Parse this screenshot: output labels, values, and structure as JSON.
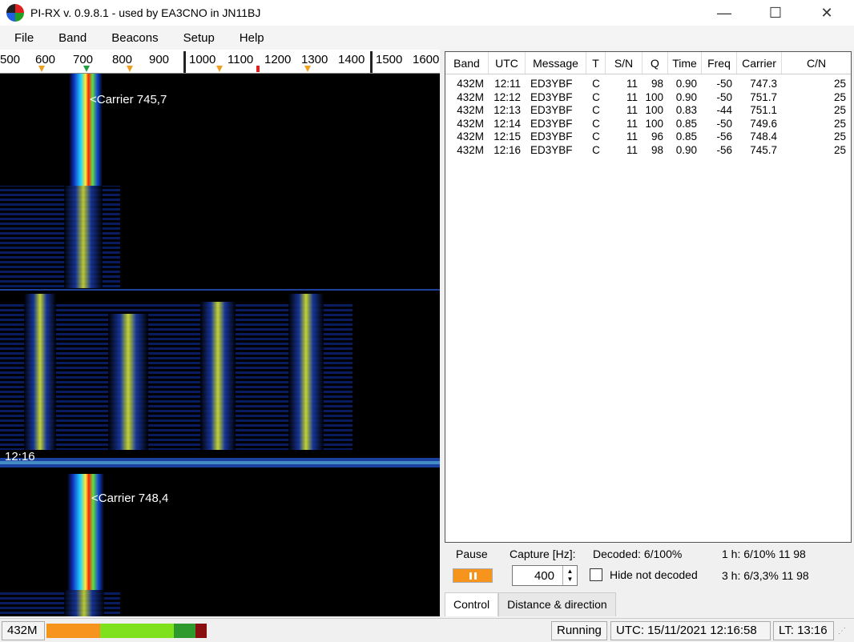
{
  "window": {
    "title": "PI-RX v. 0.9.8.1 - used by EA3CNO in JN11BJ",
    "minimize_glyph": "—",
    "maximize_glyph": "☐",
    "close_glyph": "✕"
  },
  "menu": [
    "File",
    "Band",
    "Beacons",
    "Setup",
    "Help"
  ],
  "scale_ticks": [
    "500",
    "600",
    "700",
    "800",
    "900",
    "1000",
    "1100",
    "1200",
    "1300",
    "1400",
    "1500",
    "1600"
  ],
  "waterfall": {
    "carrier_label_1": "<Carrier 745,7",
    "time_label": "12:16",
    "carrier_label_2": "<Carrier 748,4"
  },
  "table": {
    "headers": [
      "Band",
      "UTC",
      "Message",
      "T",
      "S/N",
      "Q",
      "Time",
      "Freq",
      "Carrier",
      "C/N"
    ],
    "rows": [
      [
        "432M",
        "12:11",
        "ED3YBF",
        "C",
        "11",
        "98",
        "0.90",
        "-50",
        "747.3",
        "25"
      ],
      [
        "432M",
        "12:12",
        "ED3YBF",
        "C",
        "11",
        "100",
        "0.90",
        "-50",
        "751.7",
        "25"
      ],
      [
        "432M",
        "12:13",
        "ED3YBF",
        "C",
        "11",
        "100",
        "0.83",
        "-44",
        "751.1",
        "25"
      ],
      [
        "432M",
        "12:14",
        "ED3YBF",
        "C",
        "11",
        "100",
        "0.85",
        "-50",
        "749.6",
        "25"
      ],
      [
        "432M",
        "12:15",
        "ED3YBF",
        "C",
        "11",
        "96",
        "0.85",
        "-56",
        "748.4",
        "25"
      ],
      [
        "432M",
        "12:16",
        "ED3YBF",
        "C",
        "11",
        "98",
        "0.90",
        "-56",
        "745.7",
        "25"
      ]
    ]
  },
  "controls": {
    "pause_label": "Pause",
    "capture_label": "Capture [Hz]:",
    "capture_value": "400",
    "decoded_label": "Decoded: 6/100%",
    "hide_label": "Hide not decoded",
    "stat_1h": "1 h: 6/10%  11  98",
    "stat_3h": "3 h: 6/3,3%  11  98"
  },
  "tabs": [
    "Control",
    "Distance & direction"
  ],
  "status": {
    "band": "432M",
    "state": "Running",
    "utc": "UTC:  15/11/2021  12:16:58",
    "lt": "LT:  13:16"
  },
  "colors": {
    "accent_orange": "#f7941d",
    "green": "#7fe01c",
    "dark_green": "#2e9a2e",
    "dark_red": "#8b0e0e"
  }
}
